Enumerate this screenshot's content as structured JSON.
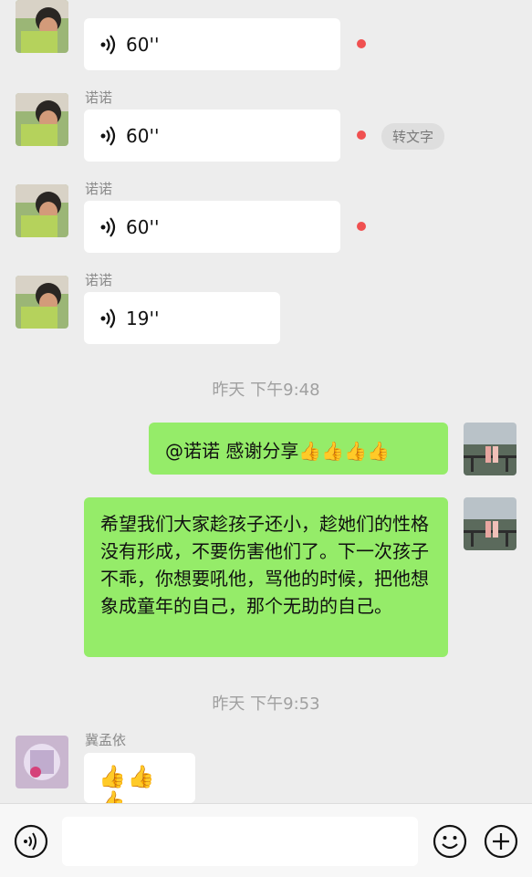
{
  "messages": [
    {
      "type": "voice",
      "sender": "",
      "duration": "60''",
      "unread": true
    },
    {
      "type": "voice",
      "sender": "诺诺",
      "duration": "60''",
      "unread": true,
      "to_text": "转文字"
    },
    {
      "type": "voice",
      "sender": "诺诺",
      "duration": "60''",
      "unread": true
    },
    {
      "type": "voice",
      "sender": "诺诺",
      "duration": "19''",
      "unread": false
    }
  ],
  "time1": "昨天 下午9:48",
  "out_messages": [
    {
      "text": "@诺诺 感谢分享👍👍👍👍"
    },
    {
      "text": "希望我们大家趁孩子还小，趁她们的性格没有形成，不要伤害他们了。下一次孩子不乖，你想要吼他，骂他的时候，把他想象成童年的自己，那个无助的自己。"
    }
  ],
  "time2": "昨天 下午9:53",
  "last_message": {
    "sender": "冀孟依",
    "text": "👍👍👍"
  },
  "input": {
    "placeholder": ""
  },
  "icons": {
    "voice_button": "voice-icon",
    "emoji_button": "smile-icon",
    "more_button": "plus-icon",
    "voice_wave": "voice-wave-icon"
  },
  "colors": {
    "background": "#ededed",
    "outgoing": "#95ec69",
    "incoming": "#ffffff",
    "unread": "#f05050"
  }
}
